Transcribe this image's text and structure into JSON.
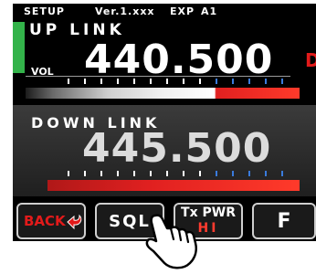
{
  "header": {
    "mode": "SETUP",
    "version": "Ver.1.xxx",
    "exp": "EXP",
    "a1": "A1"
  },
  "up_link": {
    "label": "UP LINK",
    "frequency": "440.500",
    "vol_label": "VOL",
    "side_mark": "D"
  },
  "down_link": {
    "label": "DOWN LINK",
    "frequency": "445.500"
  },
  "softkeys": {
    "back": "BACK",
    "sql": "SQL",
    "txpwr": "Tx PWR",
    "txpwr_value": "HI",
    "f": "F"
  },
  "colors": {
    "green_indicator": "#33b34a",
    "red_accent": "#e21a1a",
    "hi_red": "#ff3b2f"
  },
  "icons": {
    "back": "back-arrow-icon",
    "hand": "pointing-hand-icon"
  }
}
